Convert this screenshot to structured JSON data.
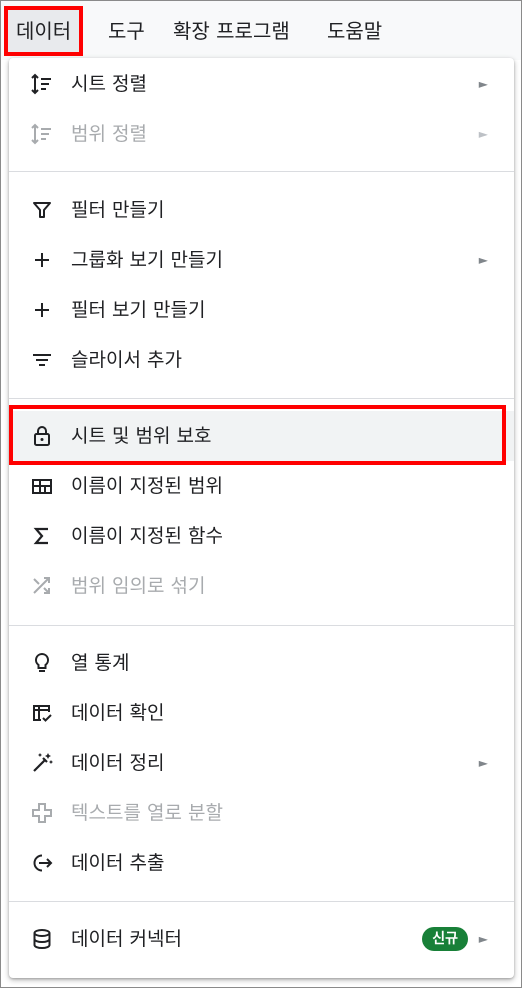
{
  "menubar": {
    "items": [
      {
        "label": "데이터"
      },
      {
        "label": "도구"
      },
      {
        "label": "확장 프로그램"
      },
      {
        "label": "도움말"
      }
    ]
  },
  "menu": {
    "items": [
      {
        "label": "시트 정렬",
        "icon": "sort-icon",
        "submenu": true
      },
      {
        "label": "범위 정렬",
        "icon": "sort-icon",
        "submenu": true,
        "disabled": true
      },
      {
        "label": "필터 만들기",
        "icon": "filter-icon"
      },
      {
        "label": "그룹화 보기 만들기",
        "icon": "plus-icon",
        "submenu": true
      },
      {
        "label": "필터 보기 만들기",
        "icon": "plus-icon"
      },
      {
        "label": "슬라이서 추가",
        "icon": "slicer-icon"
      },
      {
        "label": "시트 및 범위 보호",
        "icon": "lock-icon",
        "highlighted": true
      },
      {
        "label": "이름이 지정된 범위",
        "icon": "named-range-icon"
      },
      {
        "label": "이름이 지정된 함수",
        "icon": "sigma-icon"
      },
      {
        "label": "범위 임의로 섞기",
        "icon": "shuffle-icon",
        "disabled": true
      },
      {
        "label": "열 통계",
        "icon": "lightbulb-icon"
      },
      {
        "label": "데이터 확인",
        "icon": "data-validation-icon"
      },
      {
        "label": "데이터 정리",
        "icon": "magic-wand-icon",
        "submenu": true
      },
      {
        "label": "텍스트를 열로 분할",
        "icon": "split-columns-icon",
        "disabled": true
      },
      {
        "label": "데이터 추출",
        "icon": "extract-icon"
      },
      {
        "label": "데이터 커넥터",
        "icon": "database-icon",
        "submenu": true,
        "badge": "신규"
      }
    ],
    "submenu_arrow": "►"
  },
  "colors": {
    "highlight_border": "#ff0000",
    "badge_bg": "#188038",
    "disabled_text": "#a8abae"
  }
}
